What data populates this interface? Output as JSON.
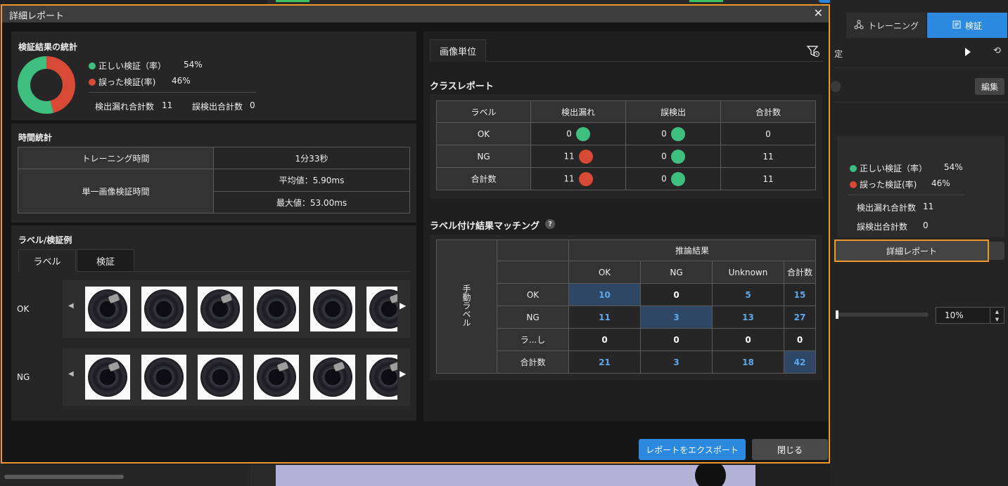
{
  "background": {
    "tabs": [
      {
        "label": "トレーニング",
        "icon": "network-icon"
      },
      {
        "label": "検証",
        "icon": "report-icon"
      }
    ],
    "settings_label": "定",
    "edit_label": "編集",
    "stats": {
      "correct_label": "正しい検証（率）",
      "correct_value": "54%",
      "wrong_label": "誤った検証(率)",
      "wrong_value": "46%",
      "missed_label": "検出漏れ合計数",
      "missed_value": "11",
      "false_label": "誤検出合計数",
      "false_value": "0"
    },
    "report_button": "詳細レポート",
    "threshold_value": "10%"
  },
  "dialog": {
    "title": "詳細レポート",
    "summary": {
      "title": "検証結果の統計",
      "correct_label": "正しい検証（率）",
      "correct_value": "54%",
      "correct_fraction": 0.54,
      "wrong_label": "誤った検証(率)",
      "wrong_value": "46%",
      "missed_label": "検出漏れ合計数",
      "missed_value": "11",
      "false_label": "誤検出合計数",
      "false_value": "0",
      "colors": {
        "correct": "#3fbf7f",
        "wrong": "#d84a35"
      }
    },
    "time": {
      "title": "時間統計",
      "training_label": "トレーニング時間",
      "training_value": "1分33秒",
      "single_label": "単一画像検証時間",
      "avg": "平均値：5.90ms",
      "max": "最大値：53.00ms"
    },
    "examples": {
      "title": "ラベル/検証例",
      "tabs": [
        "ラベル",
        "検証"
      ],
      "rows": [
        {
          "label": "OK",
          "thumbs": 6
        },
        {
          "label": "NG",
          "thumbs": 6
        }
      ]
    },
    "right": {
      "tab": "画像単位",
      "class_report_title": "クラスレポート",
      "class_report": {
        "headers": [
          "ラベル",
          "検出漏れ",
          "誤検出",
          "合計数"
        ],
        "rows": [
          {
            "label": "OK",
            "missed": "0",
            "missed_status": "green",
            "false": "0",
            "false_status": "green",
            "total": "0"
          },
          {
            "label": "NG",
            "missed": "11",
            "missed_status": "red",
            "false": "0",
            "false_status": "green",
            "total": "11"
          },
          {
            "label": "合計数",
            "missed": "11",
            "missed_status": "red",
            "false": "0",
            "false_status": "green",
            "total": "11"
          }
        ]
      },
      "matching_title": "ラベル付け結果マッチング",
      "matching": {
        "inference_header": "推論結果",
        "manual_header": "手動ラベル",
        "columns": [
          "OK",
          "NG",
          "Unknown",
          "合計数"
        ],
        "rows": [
          {
            "label": "OK",
            "values": [
              "10",
              "0",
              "5",
              "15"
            ]
          },
          {
            "label": "NG",
            "values": [
              "11",
              "3",
              "13",
              "27"
            ]
          },
          {
            "label": "ラ...し",
            "values": [
              "0",
              "0",
              "0",
              "0"
            ]
          },
          {
            "label": "合計数",
            "values": [
              "21",
              "3",
              "18",
              "42"
            ]
          }
        ]
      }
    },
    "export_button": "レポートをエクスポート",
    "close_button": "閉じる"
  }
}
